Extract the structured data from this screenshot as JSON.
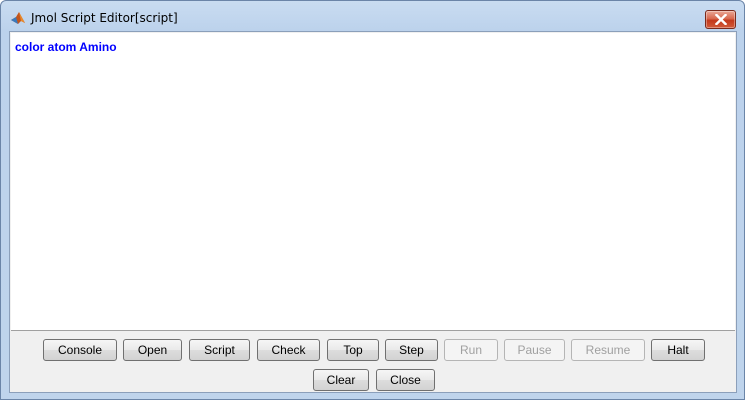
{
  "window": {
    "title": "Jmol Script Editor[script]"
  },
  "editor": {
    "content": "color atom Amino",
    "text_color": "#0000ff"
  },
  "toolbar": {
    "row1": [
      {
        "id": "console",
        "label": "Console",
        "enabled": true
      },
      {
        "id": "open",
        "label": "Open",
        "enabled": true
      },
      {
        "id": "script",
        "label": "Script",
        "enabled": true
      },
      {
        "id": "check",
        "label": "Check",
        "enabled": true
      },
      {
        "id": "top",
        "label": "Top",
        "enabled": true
      },
      {
        "id": "step",
        "label": "Step",
        "enabled": true
      },
      {
        "id": "run",
        "label": "Run",
        "enabled": false
      },
      {
        "id": "pause",
        "label": "Pause",
        "enabled": false
      },
      {
        "id": "resume",
        "label": "Resume",
        "enabled": false
      },
      {
        "id": "halt",
        "label": "Halt",
        "enabled": true
      }
    ],
    "row2": [
      {
        "id": "clear",
        "label": "Clear",
        "enabled": true
      },
      {
        "id": "close",
        "label": "Close",
        "enabled": true
      }
    ]
  },
  "icons": {
    "app": "matlab-logo-icon",
    "close": "close-icon"
  }
}
